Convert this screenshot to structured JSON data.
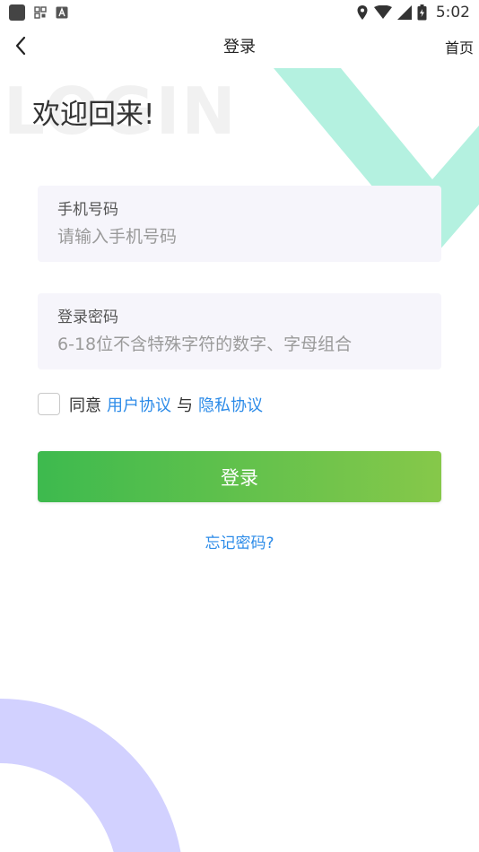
{
  "status_bar": {
    "time": "5:02",
    "icons": [
      "app-square-icon",
      "qr-grid-icon",
      "a-badge-icon",
      "location-icon",
      "wifi-icon",
      "signal-icon",
      "battery-icon"
    ]
  },
  "nav": {
    "title": "登录",
    "home_label": "首页",
    "back_icon": "chevron-left-icon"
  },
  "welcome": {
    "watermark": "LOGIN",
    "title": "欢迎回来!"
  },
  "form": {
    "phone": {
      "label": "手机号码",
      "placeholder": "请输入手机号码",
      "value": ""
    },
    "password": {
      "label": "登录密码",
      "placeholder": "6-18位不含特殊字符的数字、字母组合",
      "value": ""
    }
  },
  "agreement": {
    "checked": false,
    "prefix": "同意",
    "user_agreement": "用户协议",
    "conjunction": "与",
    "privacy_agreement": "隐私协议"
  },
  "login_button": "登录",
  "forgot_password": "忘记密码?",
  "colors": {
    "accent_blue": "#2c8be8",
    "button_gradient_start": "#3dba4e",
    "button_gradient_end": "#86c84a",
    "teal_decoration": "#b4f1e0",
    "purple_decoration": "#d2d1ff",
    "field_background": "#f6f5fb"
  }
}
